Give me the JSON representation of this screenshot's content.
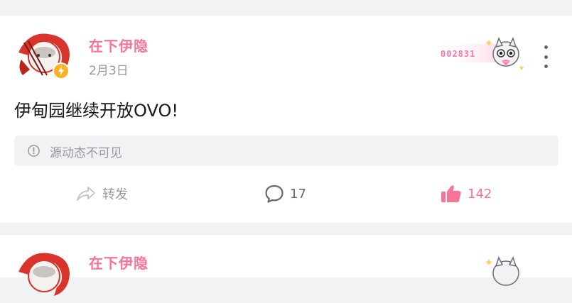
{
  "post": {
    "author": "在下伊隐",
    "date": "2月3日",
    "fan_badge_number": "002831",
    "text": "伊甸园继续开放OVO!",
    "source_notice": "源动态不可见",
    "actions": {
      "forward_label": "转发",
      "comment_count": "17",
      "like_count": "142"
    }
  },
  "next_post": {
    "author": "在下伊隐"
  },
  "colors": {
    "accent_pink": "#fb7299",
    "muted_gray": "#9499a0",
    "text_dark": "#18191c",
    "background": "#f1f2f3"
  },
  "icons": [
    "avatar",
    "lightning-badge-icon",
    "fan-badge-mascot-icon",
    "more-vertical-icon",
    "info-circle-icon",
    "forward-icon",
    "comment-icon",
    "thumbs-up-icon"
  ]
}
